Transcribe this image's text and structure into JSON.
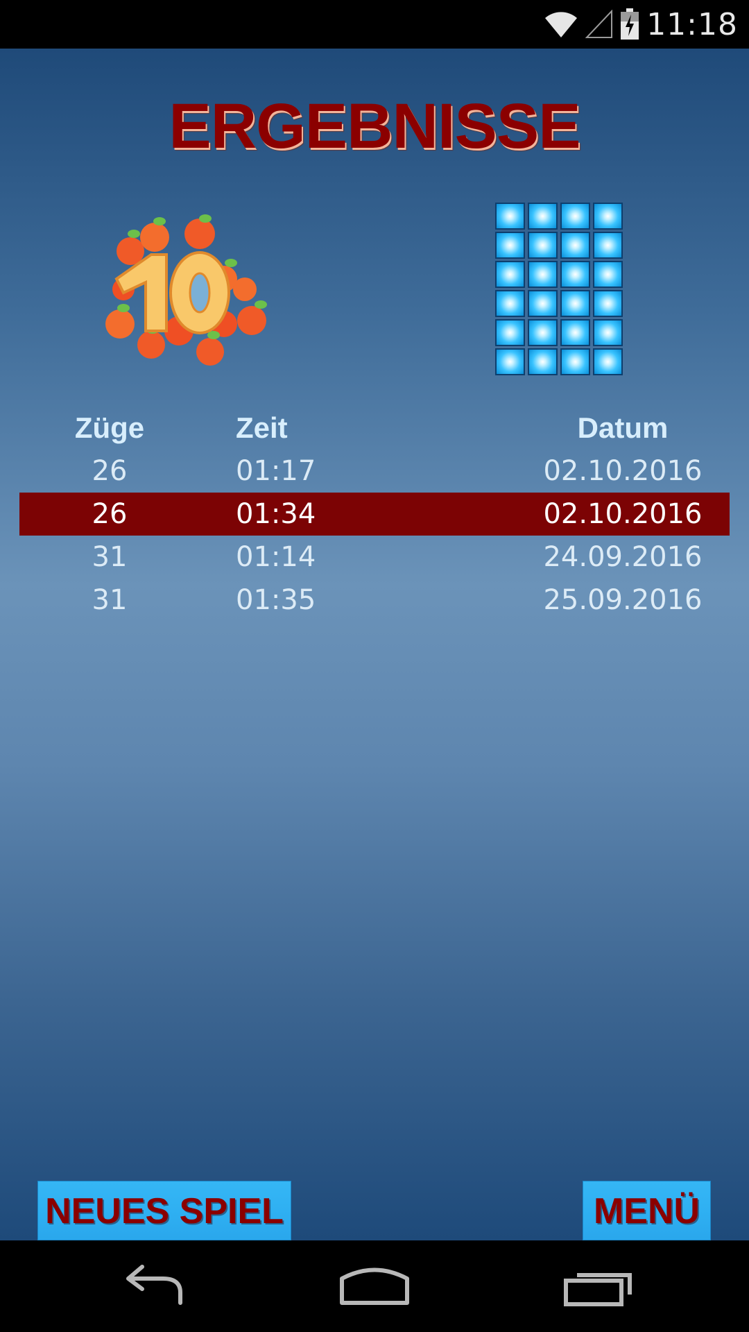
{
  "status_bar": {
    "time": "11:18",
    "icons": [
      "wifi-icon",
      "signal-icon",
      "battery-charging-icon"
    ]
  },
  "screen": {
    "title": "ERGEBNISSE",
    "logo_text": "10",
    "grid": {
      "columns": 4,
      "rows": 6
    }
  },
  "results": {
    "headers": {
      "moves": "Züge",
      "time": "Zeit",
      "date": "Datum"
    },
    "rows": [
      {
        "moves": "26",
        "time": "01:17",
        "date": "02.10.2016",
        "highlighted": false
      },
      {
        "moves": "26",
        "time": "01:34",
        "date": "02.10.2016",
        "highlighted": true
      },
      {
        "moves": "31",
        "time": "01:14",
        "date": "24.09.2016",
        "highlighted": false
      },
      {
        "moves": "31",
        "time": "01:35",
        "date": "25.09.2016",
        "highlighted": false
      }
    ]
  },
  "buttons": {
    "new_game": "NEUES SPIEL",
    "menu": "MENÜ"
  },
  "navigation": [
    "back-icon",
    "home-icon",
    "recent-apps-icon"
  ],
  "colors": {
    "title": "#8b0000",
    "highlight_row": "#7c0304",
    "button": "#2fb0f2",
    "button_text": "#8b0000",
    "header_text": "#d8eefc"
  }
}
